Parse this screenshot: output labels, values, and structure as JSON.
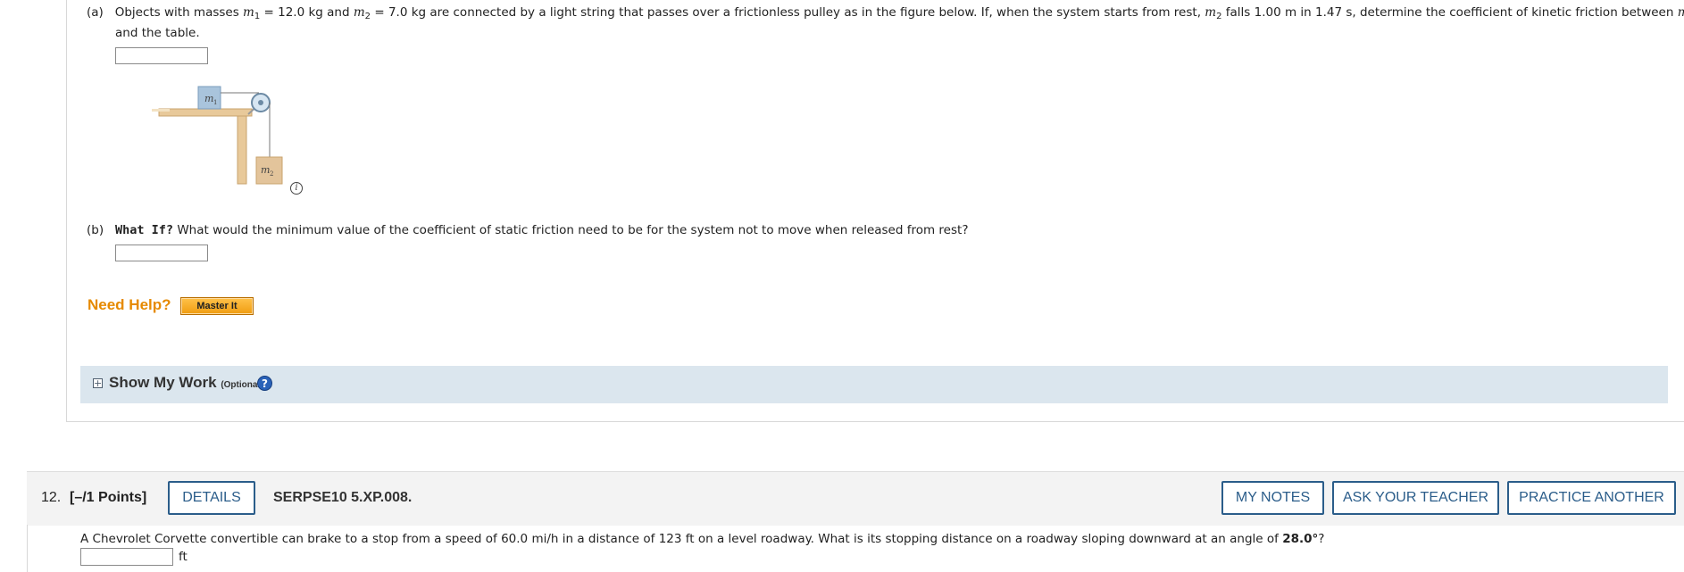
{
  "part_a": {
    "label": "(a)",
    "text_1": "Objects with masses",
    "m": "m",
    "sub_1": "1",
    "text_2": "= 12.0 kg and",
    "sub_2": "2",
    "text_3": "= 7.0 kg are connected by a light string that passes over a frictionless pulley as in the figure below. If, when the system starts from rest,",
    "text_4": "falls 1.00 m in 1.47 s, determine the coefficient of kinetic friction between",
    "text_line2": "and the table."
  },
  "figure": {
    "label_m1": "m",
    "label_m1_sub": "1",
    "label_m2": "m",
    "label_m2_sub": "2",
    "info_glyph": "i"
  },
  "part_b": {
    "label": "(b)",
    "bold": "What If?",
    "text": "What would the minimum value of the coefficient of static friction need to be for the system not to move when released from rest?"
  },
  "help": {
    "need_help": "Need Help?",
    "master_it": "Master It"
  },
  "show_my_work": {
    "toggle": "+",
    "title": "Show My Work",
    "optional": "(Optional)",
    "help_glyph": "?"
  },
  "question_12": {
    "number": "12.",
    "points": "[–/1 Points]",
    "details_label": "DETAILS",
    "code": "SERPSE10 5.XP.008.",
    "my_notes": "MY NOTES",
    "ask_teacher": "ASK YOUR TEACHER",
    "practice_another": "PRACTICE ANOTHER",
    "prompt_1": "A Chevrolet Corvette convertible can brake to a stop from a speed of 60.0 mi/h in a distance of 123 ft on a level roadway. What is its stopping distance on a roadway sloping downward at an angle of",
    "angle": "28.0°",
    "prompt_2": "?",
    "unit": "ft"
  }
}
